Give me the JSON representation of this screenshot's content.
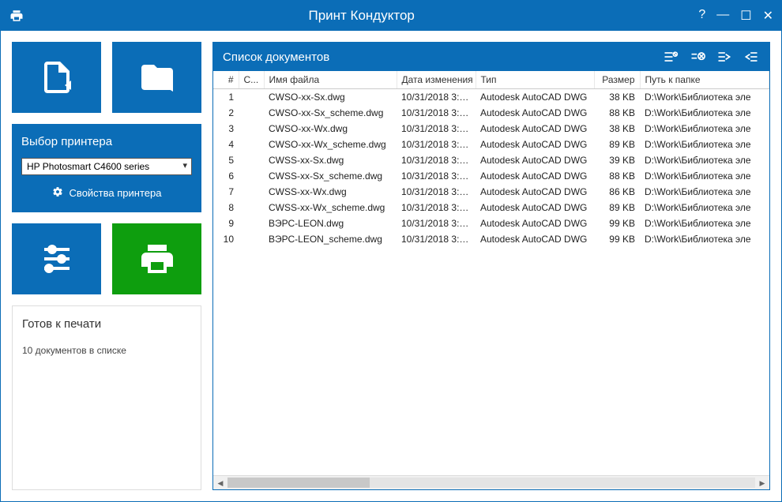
{
  "app": {
    "title": "Принт Кондуктор"
  },
  "sidebar": {
    "printer_panel_title": "Выбор принтера",
    "printer_selected": "HP Photosmart C4600 series",
    "printer_properties": "Свойства принтера"
  },
  "status": {
    "title": "Готов к печати",
    "text": "10 документов в списке"
  },
  "doclist": {
    "title": "Список документов",
    "columns": {
      "num": "#",
      "status": "С...",
      "filename": "Имя файла",
      "modified": "Дата изменения",
      "type": "Тип",
      "size": "Размер",
      "path": "Путь к папке"
    },
    "rows": [
      {
        "n": "1",
        "name": "CWSO-xx-Sx.dwg",
        "date": "10/31/2018 3:5...",
        "type": "Autodesk AutoCAD DWG",
        "size": "38 KB",
        "path": "D:\\Work\\Библиотека эле"
      },
      {
        "n": "2",
        "name": "CWSO-xx-Sx_scheme.dwg",
        "date": "10/31/2018 3:5...",
        "type": "Autodesk AutoCAD DWG",
        "size": "88 KB",
        "path": "D:\\Work\\Библиотека эле"
      },
      {
        "n": "3",
        "name": "CWSO-xx-Wx.dwg",
        "date": "10/31/2018 3:5...",
        "type": "Autodesk AutoCAD DWG",
        "size": "38 KB",
        "path": "D:\\Work\\Библиотека эле"
      },
      {
        "n": "4",
        "name": "CWSO-xx-Wx_scheme.dwg",
        "date": "10/31/2018 3:5...",
        "type": "Autodesk AutoCAD DWG",
        "size": "89 KB",
        "path": "D:\\Work\\Библиотека эле"
      },
      {
        "n": "5",
        "name": "CWSS-xx-Sx.dwg",
        "date": "10/31/2018 3:5...",
        "type": "Autodesk AutoCAD DWG",
        "size": "39 KB",
        "path": "D:\\Work\\Библиотека эле"
      },
      {
        "n": "6",
        "name": "CWSS-xx-Sx_scheme.dwg",
        "date": "10/31/2018 3:5...",
        "type": "Autodesk AutoCAD DWG",
        "size": "88 KB",
        "path": "D:\\Work\\Библиотека эле"
      },
      {
        "n": "7",
        "name": "CWSS-xx-Wx.dwg",
        "date": "10/31/2018 3:5...",
        "type": "Autodesk AutoCAD DWG",
        "size": "86 KB",
        "path": "D:\\Work\\Библиотека эле"
      },
      {
        "n": "8",
        "name": "CWSS-xx-Wx_scheme.dwg",
        "date": "10/31/2018 3:5...",
        "type": "Autodesk AutoCAD DWG",
        "size": "89 KB",
        "path": "D:\\Work\\Библиотека эле"
      },
      {
        "n": "9",
        "name": "ВЭРС-LEON.dwg",
        "date": "10/31/2018 3:5...",
        "type": "Autodesk AutoCAD DWG",
        "size": "99 KB",
        "path": "D:\\Work\\Библиотека эле"
      },
      {
        "n": "10",
        "name": "ВЭРС-LEON_scheme.dwg",
        "date": "10/31/2018 3:5...",
        "type": "Autodesk AutoCAD DWG",
        "size": "99 KB",
        "path": "D:\\Work\\Библиотека эле"
      }
    ]
  }
}
